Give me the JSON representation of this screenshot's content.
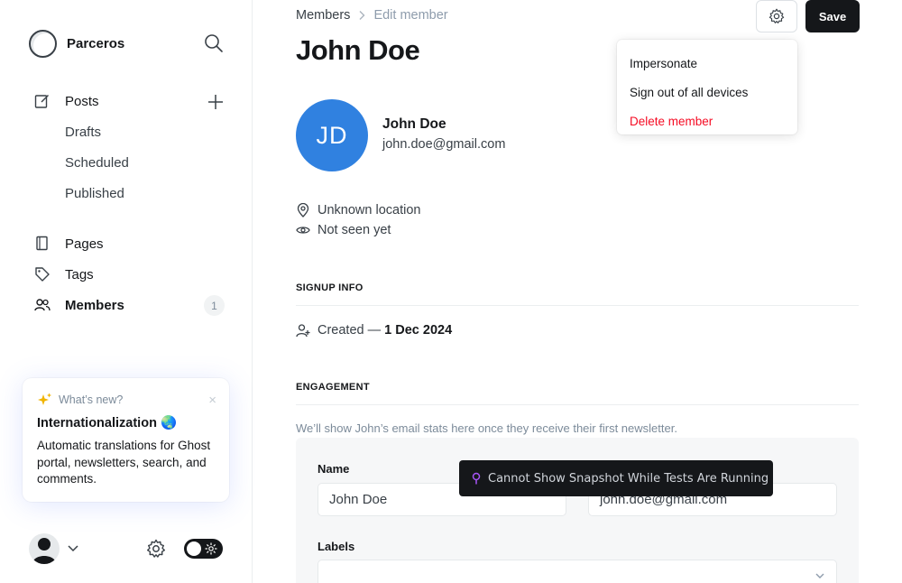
{
  "sidebar": {
    "brand": "Parceros",
    "nav": {
      "posts": "Posts",
      "drafts": "Drafts",
      "scheduled": "Scheduled",
      "published": "Published",
      "pages": "Pages",
      "tags": "Tags",
      "members": "Members",
      "members_count": "1"
    },
    "whats_new": {
      "label": "What’s new?",
      "title": "Internationalization 🌏",
      "body": "Automatic translations for Ghost portal, newsletters, search, and comments.",
      "close": "×"
    }
  },
  "header": {
    "breadcrumb_root": "Members",
    "breadcrumb_current": "Edit member",
    "title": "John Doe",
    "save_label": "Save"
  },
  "dropdown": {
    "impersonate": "Impersonate",
    "sign_out": "Sign out of all devices",
    "delete": "Delete member"
  },
  "member": {
    "initials": "JD",
    "name": "John Doe",
    "email": "john.doe@gmail.com",
    "location": "Unknown location",
    "seen": "Not seen yet"
  },
  "signup": {
    "section_title": "SIGNUP INFO",
    "created_prefix": "Created —",
    "created_date": "1 Dec 2024"
  },
  "engagement": {
    "section_title": "ENGAGEMENT",
    "note": "We’ll show John’s email stats here once they receive their first newsletter."
  },
  "form": {
    "name_label": "Name",
    "name_value": "John Doe",
    "email_value": "john.doe@gmail.com",
    "labels_label": "Labels"
  },
  "toast": {
    "text": "Cannot Show Snapshot While Tests Are Running"
  },
  "colors": {
    "accent_blue": "#3081e0",
    "danger": "#f50b23",
    "dark": "#15171a"
  }
}
